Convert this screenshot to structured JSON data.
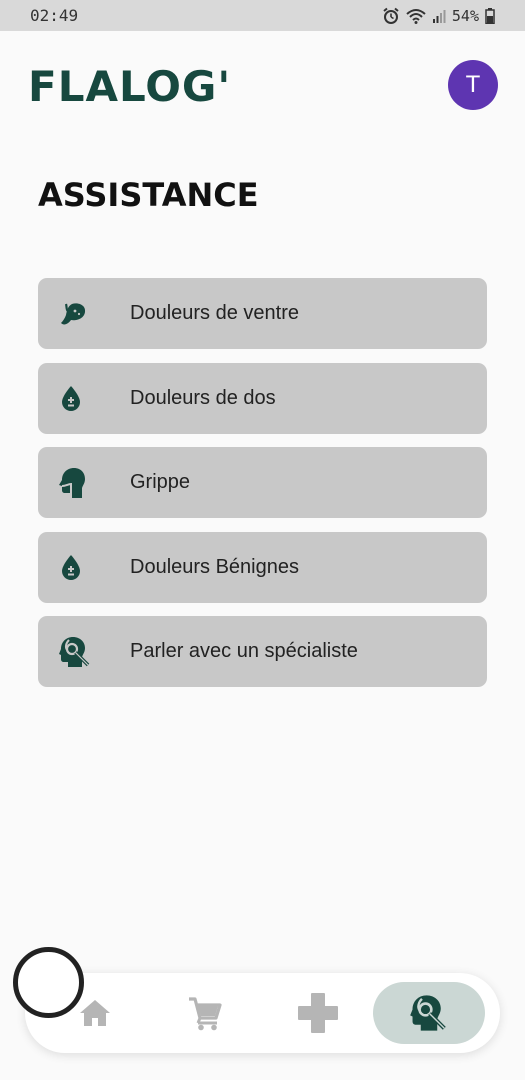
{
  "status_bar": {
    "time": "02:49",
    "battery": "54%"
  },
  "header": {
    "app_title": "FLALOG'",
    "avatar_initial": "T"
  },
  "page": {
    "title": "ASSISTANCE"
  },
  "menu": {
    "items": [
      {
        "label": "Douleurs de ventre",
        "icon": "stomach-icon"
      },
      {
        "label": "Douleurs de dos",
        "icon": "blood-drop-icon"
      },
      {
        "label": "Grippe",
        "icon": "head-throat-icon"
      },
      {
        "label": "Douleurs Bénignes",
        "icon": "blood-drop-icon"
      },
      {
        "label": "Parler avec un spécialiste",
        "icon": "specialist-icon"
      }
    ]
  },
  "bottom_nav": {
    "items": [
      "home-icon",
      "cart-icon",
      "medical-cross-icon",
      "specialist-icon"
    ],
    "active": "specialist-icon"
  },
  "colors": {
    "brand": "#17483f",
    "avatar": "#5e35b1",
    "item_bg": "#c8c8c8",
    "nav_active_bg": "#cbd7d4",
    "nav_inactive": "#b5b5b5"
  }
}
